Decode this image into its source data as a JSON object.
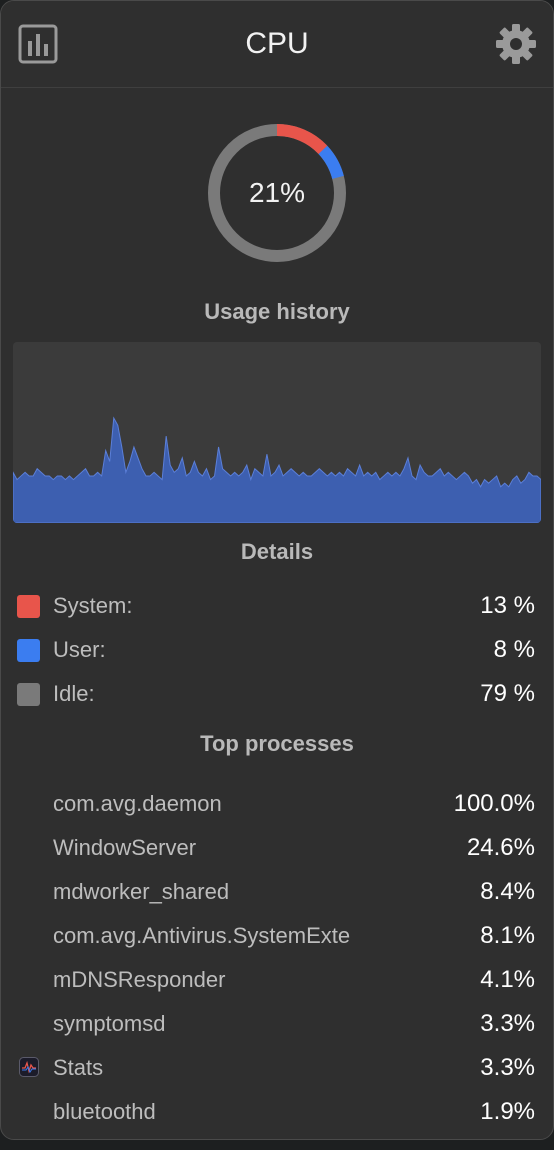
{
  "header": {
    "title": "CPU",
    "left_button_icon": "bar-chart-icon",
    "right_button_icon": "gear-icon"
  },
  "usage": {
    "label": "21%",
    "system_fraction": 0.13,
    "user_fraction": 0.08,
    "colors": {
      "system": "#e8554b",
      "user": "#3b7df0",
      "track": "#7a7a7a"
    }
  },
  "history": {
    "title": "Usage history",
    "fill_color": "#3d5fb0",
    "values": [
      14,
      12,
      13,
      14,
      13,
      13,
      15,
      14,
      13,
      13,
      12,
      13,
      13,
      12,
      13,
      12,
      13,
      14,
      15,
      13,
      13,
      14,
      13,
      20,
      17,
      29,
      27,
      21,
      14,
      17,
      21,
      18,
      15,
      13,
      13,
      14,
      13,
      12,
      24,
      16,
      14,
      15,
      18,
      13,
      14,
      17,
      14,
      13,
      15,
      12,
      13,
      21,
      15,
      14,
      13,
      14,
      13,
      14,
      16,
      12,
      15,
      14,
      13,
      19,
      13,
      14,
      16,
      13,
      14,
      15,
      14,
      13,
      14,
      13,
      13,
      14,
      15,
      14,
      13,
      14,
      13,
      14,
      13,
      15,
      14,
      13,
      16,
      13,
      14,
      13,
      14,
      12,
      13,
      14,
      13,
      14,
      13,
      15,
      18,
      13,
      12,
      16,
      14,
      13,
      13,
      14,
      15,
      13,
      14,
      13,
      12,
      13,
      14,
      13,
      11,
      12,
      10,
      12,
      11,
      12,
      13,
      10,
      11,
      10,
      12,
      13,
      11,
      12,
      14,
      13,
      13,
      12
    ]
  },
  "details": {
    "title": "Details",
    "rows": [
      {
        "label": "System:",
        "value": "13 %",
        "color": "#e8554b"
      },
      {
        "label": "User:",
        "value": "8 %",
        "color": "#3b7df0"
      },
      {
        "label": "Idle:",
        "value": "79 %",
        "color": "#7a7a7a"
      }
    ]
  },
  "processes": {
    "title": "Top processes",
    "rows": [
      {
        "name": "com.avg.daemon",
        "value": "100.0%"
      },
      {
        "name": "WindowServer",
        "value": "24.6%"
      },
      {
        "name": "mdworker_shared",
        "value": "8.4%"
      },
      {
        "name": "com.avg.Antivirus.SystemExte",
        "value": "8.1%"
      },
      {
        "name": "mDNSResponder",
        "value": "4.1%"
      },
      {
        "name": "symptomsd",
        "value": "3.3%"
      },
      {
        "name": "Stats",
        "value": "3.3%",
        "icon": "stats-app-icon"
      },
      {
        "name": "bluetoothd",
        "value": "1.9%"
      }
    ]
  }
}
